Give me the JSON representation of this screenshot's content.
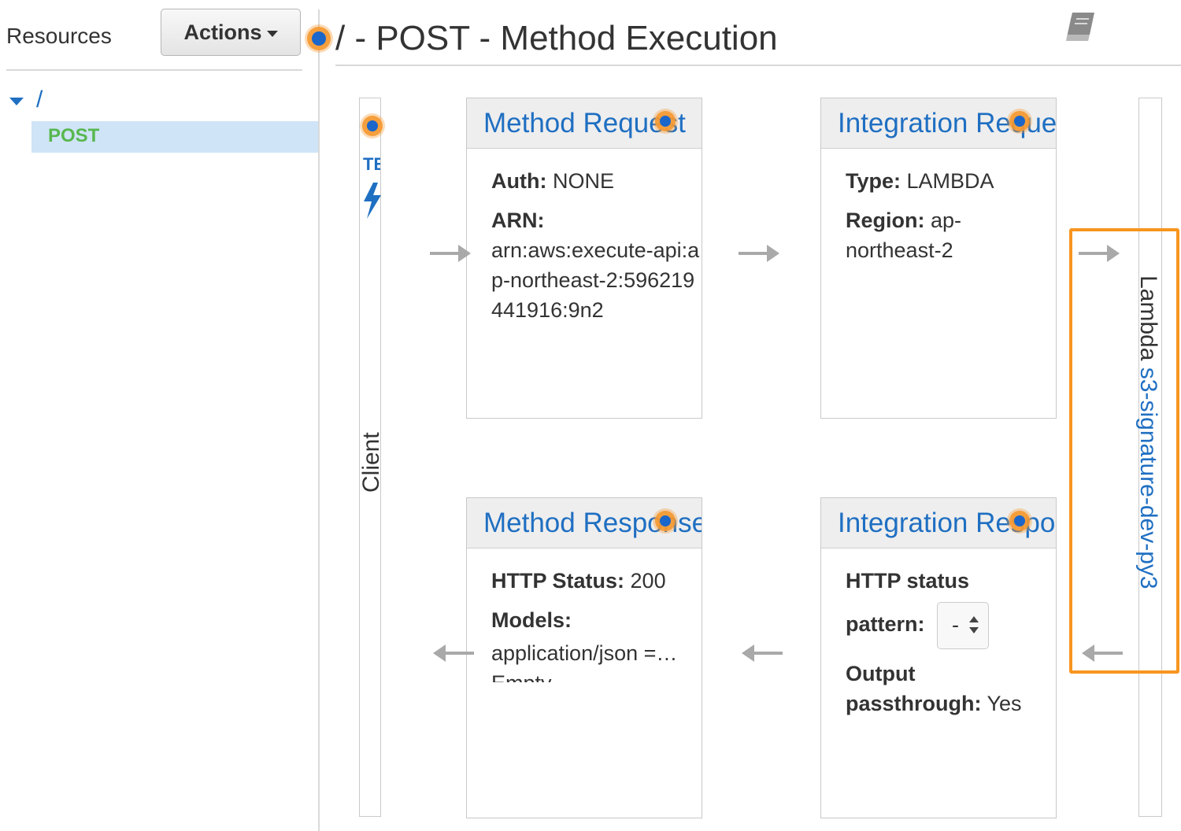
{
  "sidebar": {
    "title": "Resources",
    "actions_label": "Actions",
    "tree_root": "/",
    "tree_method": "POST"
  },
  "header": {
    "title": "/ - POST - Method Execution",
    "book_icon": "book-icon"
  },
  "client": {
    "label": "Client",
    "test_label": "TEST",
    "test_icon": "lightning-bolt-icon"
  },
  "method_request": {
    "title": "Method Request",
    "auth_key": "Auth:",
    "auth_value": "NONE",
    "arn_key": "ARN:",
    "arn_value": "arn:aws:execute-api:ap-northeast-2:596219441916:9n2"
  },
  "integration_request": {
    "title": "Integration Request",
    "type_key": "Type:",
    "type_value": "LAMBDA",
    "region_key": "Region:",
    "region_value": "ap-northeast-2"
  },
  "method_response": {
    "title": "Method Response",
    "status_key": "HTTP Status:",
    "status_value": "200",
    "models_key": "Models:",
    "models_value": "application/json =…",
    "models_value_2": "Empty"
  },
  "integration_response": {
    "title": "Integration Response",
    "status_pattern_key_1": "HTTP status",
    "status_pattern_key_2": "pattern:",
    "status_pattern_select": "-",
    "output_key_1": "Output",
    "output_key_2": "passthrough:",
    "output_value": "Yes"
  },
  "lambda": {
    "prefix": "Lambda",
    "function_name": "s3-signature-dev-py3"
  },
  "colors": {
    "link_blue": "#1f6fc2",
    "method_green": "#58b74f",
    "hotspot_orange": "#f7951f",
    "selected_row": "#cfe4f7"
  }
}
